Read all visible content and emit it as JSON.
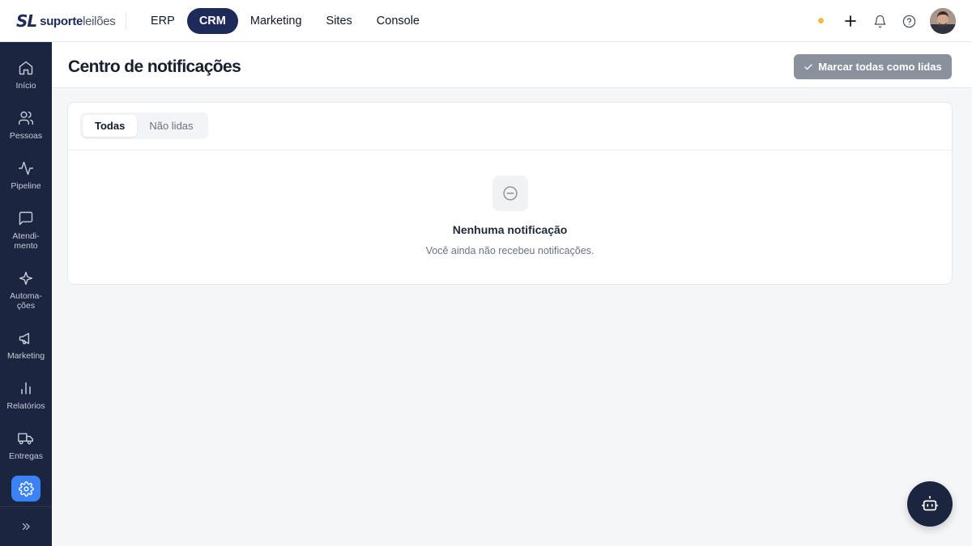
{
  "brand": {
    "mark": "SL",
    "name_bold": "suporte",
    "name_light": "leilões"
  },
  "topnav": [
    {
      "label": "ERP",
      "active": false
    },
    {
      "label": "CRM",
      "active": true
    },
    {
      "label": "Marketing",
      "active": false
    },
    {
      "label": "Sites",
      "active": false
    },
    {
      "label": "Console",
      "active": false
    }
  ],
  "topbar_icons": [
    "status-dot",
    "plus-icon",
    "bell-icon",
    "help-icon",
    "avatar"
  ],
  "sidebar": {
    "items": [
      {
        "label": "Início",
        "icon": "home-icon"
      },
      {
        "label": "Pessoas",
        "icon": "users-icon"
      },
      {
        "label": "Pipeline",
        "icon": "activity-icon"
      },
      {
        "label": "Atendi-\nmento",
        "icon": "message-icon"
      },
      {
        "label": "Automa-\nções",
        "icon": "sparkle-icon"
      },
      {
        "label": "Marketing",
        "icon": "megaphone-icon"
      },
      {
        "label": "Relatórios",
        "icon": "bar-chart-icon"
      },
      {
        "label": "Entregas",
        "icon": "truck-icon"
      }
    ],
    "active_tool": "gear-icon",
    "expand": "chevrons-right-icon"
  },
  "page": {
    "title": "Centro de notificações",
    "mark_all_label": "Marcar todas como lidas"
  },
  "tabs": [
    {
      "label": "Todas",
      "active": true
    },
    {
      "label": "Não lidas",
      "active": false
    }
  ],
  "empty_state": {
    "icon": "minus-circle-icon",
    "title": "Nenhuma notificação",
    "subtitle": "Você ainda não recebeu notificações."
  },
  "fab": {
    "icon": "bot-icon"
  },
  "colors": {
    "navy": "#1e2a5a",
    "sidebar_bg": "#1c2540",
    "accent_blue": "#3b82f6",
    "status_dot": "#f5b94a",
    "button_gray": "#8a909c",
    "page_bg": "#f5f6f8"
  }
}
